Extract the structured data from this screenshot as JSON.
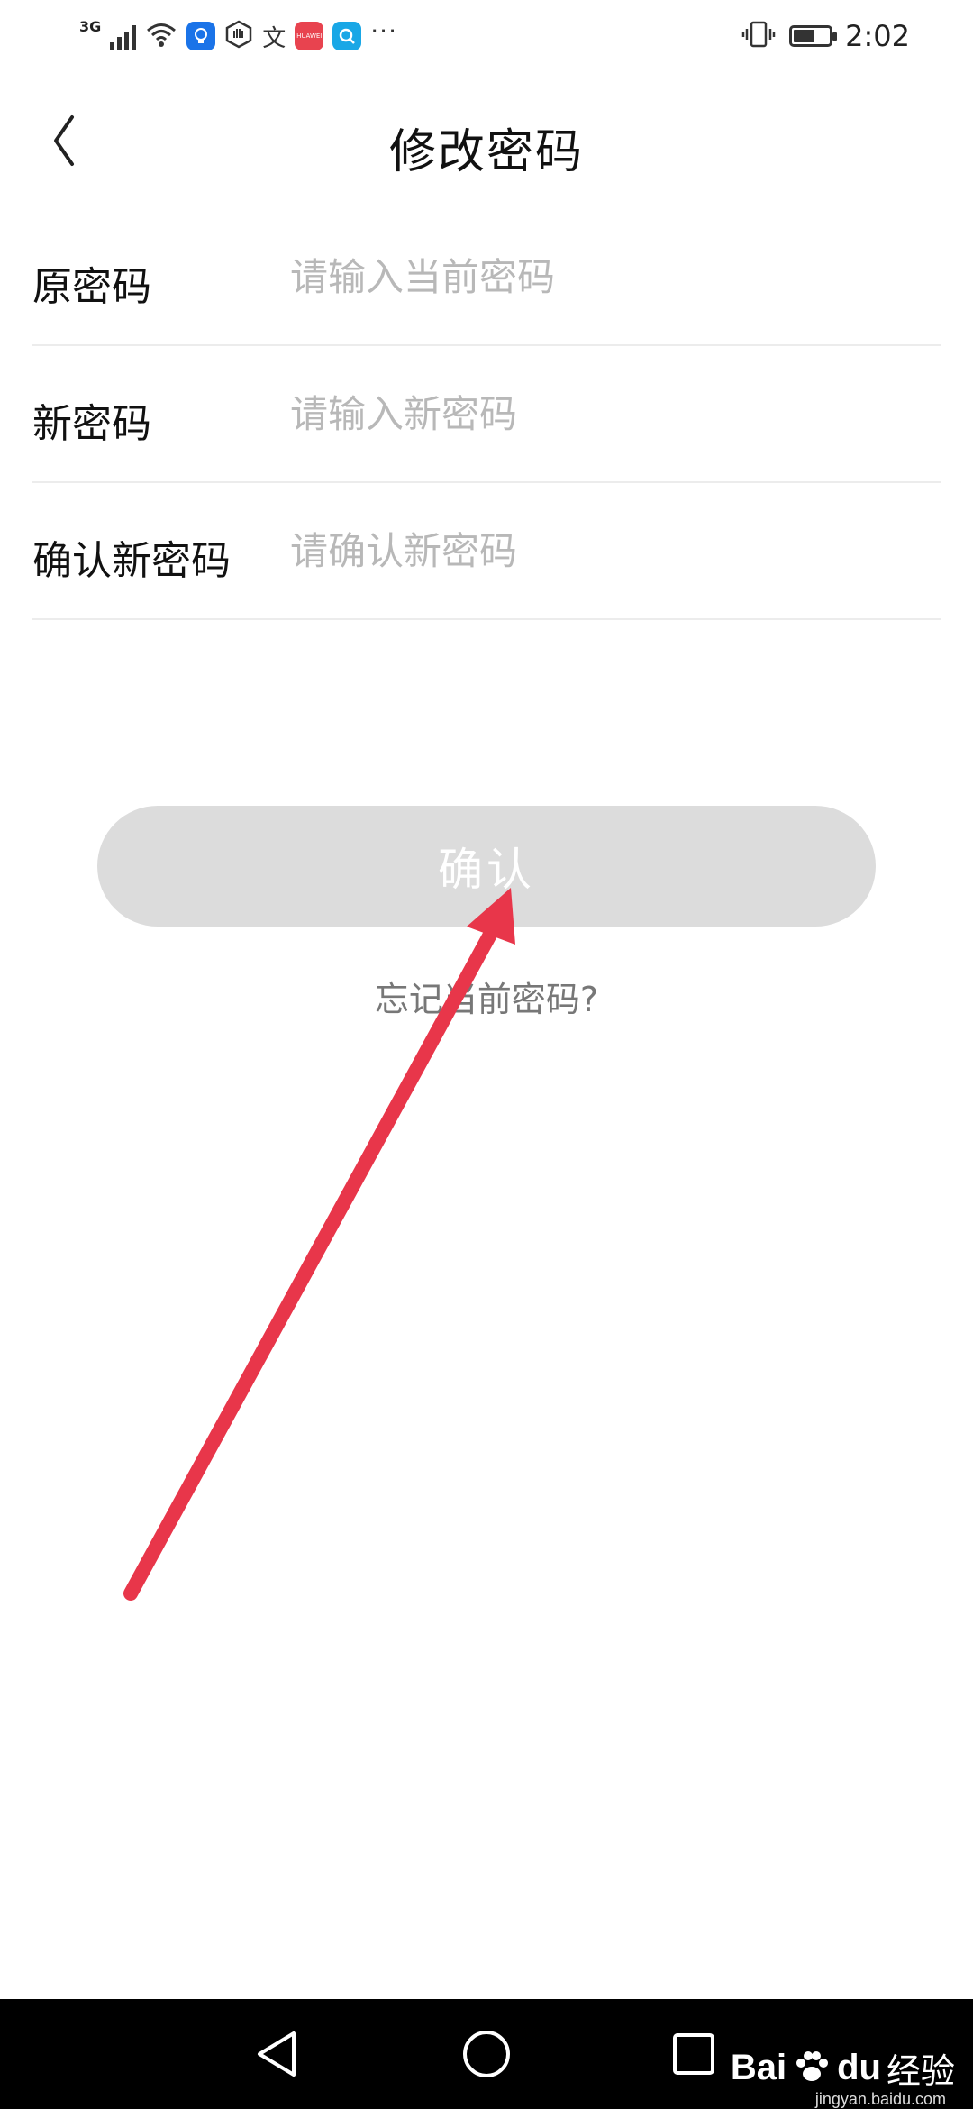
{
  "status_bar": {
    "network": "3G",
    "time": "2:02",
    "battery_level": 0.6,
    "overflow": "···",
    "icons": [
      "signal-icon",
      "wifi-icon",
      "bulb-app-icon",
      "hand-app-icon",
      "text-app-icon",
      "huawei-app-icon",
      "search-app-icon",
      "vibrate-icon",
      "battery-icon"
    ],
    "app_text": {
      "text": "文",
      "huawei": "HUAWEI"
    }
  },
  "header": {
    "title": "修改密码",
    "back_icon": "chevron-left-icon"
  },
  "form": {
    "fields": [
      {
        "label": "原密码",
        "value": "",
        "placeholder": "请输入当前密码"
      },
      {
        "label": "新密码",
        "value": "",
        "placeholder": "请输入新密码"
      },
      {
        "label": "确认新密码",
        "value": "",
        "placeholder": "请确认新密码"
      }
    ]
  },
  "actions": {
    "confirm_label": "确认",
    "forgot_label": "忘记当前密码?"
  },
  "annotation": {
    "color": "#e8364a",
    "icon": "arrow-icon"
  },
  "nav_bar": {
    "icons": [
      "back-triangle-icon",
      "home-circle-icon",
      "recents-square-icon"
    ]
  },
  "watermark": {
    "brand": "Bai",
    "brand2": "du",
    "cn": "经验",
    "url": "jingyan.baidu.com"
  },
  "colors": {
    "button_disabled": "#dcdcdc",
    "placeholder": "#b8b8b8",
    "divider": "#ececec"
  }
}
